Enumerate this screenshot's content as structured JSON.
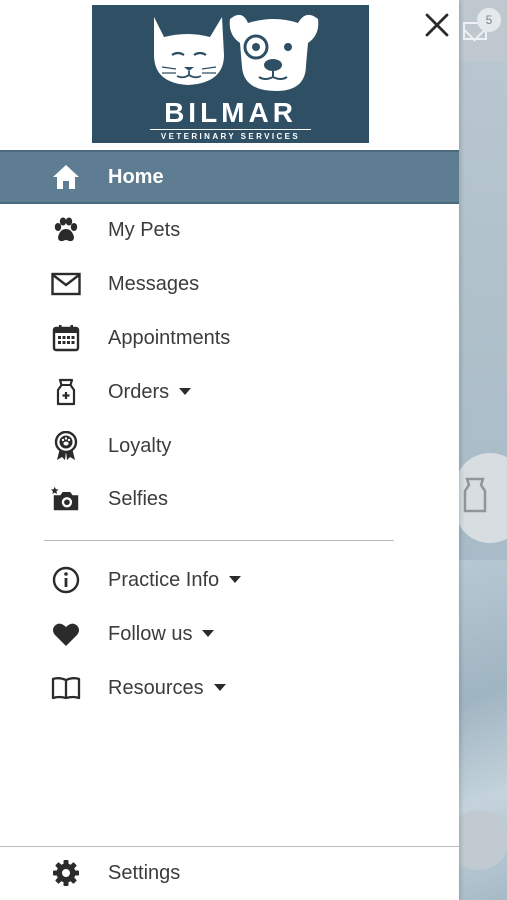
{
  "logo": {
    "brand": "BILMAR",
    "subtitle": "VETERINARY SERVICES"
  },
  "menu": {
    "home": "Home",
    "my_pets": "My Pets",
    "messages": "Messages",
    "appointments": "Appointments",
    "orders": "Orders",
    "loyalty": "Loyalty",
    "selfies": "Selfies",
    "practice_info": "Practice Info",
    "follow_us": "Follow us",
    "resources": "Resources",
    "settings": "Settings"
  },
  "background": {
    "mail_badge_count": "5"
  },
  "colors": {
    "active_bg": "#5e7d92",
    "logo_bg": "#2e4f64",
    "text": "#3c3c3c"
  }
}
